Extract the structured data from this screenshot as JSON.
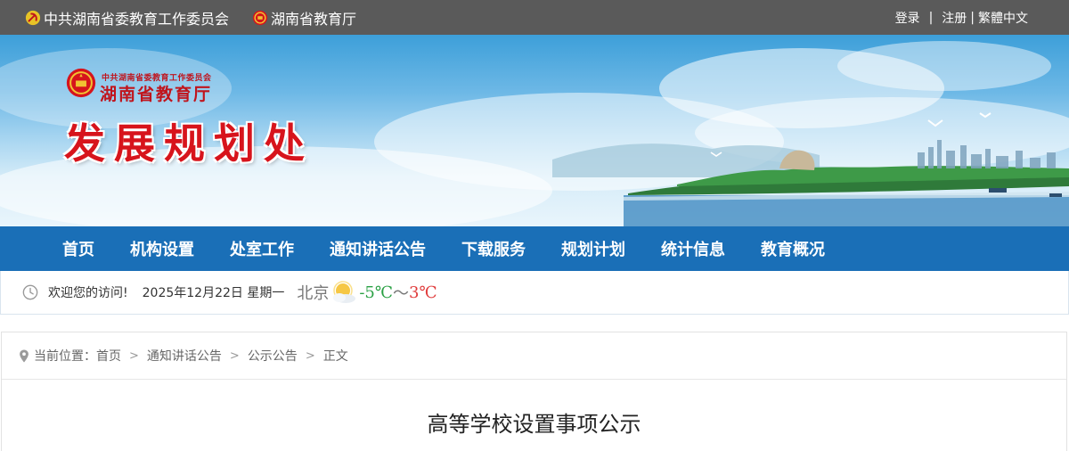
{
  "topbar": {
    "org1": "中共湖南省委教育工作委员会",
    "org2": "湖南省教育厅",
    "login": "登录",
    "register": "注册",
    "traditional": "繁體中文"
  },
  "banner": {
    "sub": "中共湖南省委教育工作委员会",
    "dept": "湖南省教育厅",
    "office": "发展规划处"
  },
  "nav": {
    "items": [
      {
        "label": "首页"
      },
      {
        "label": "机构设置"
      },
      {
        "label": "处室工作"
      },
      {
        "label": "通知讲话公告"
      },
      {
        "label": "下载服务"
      },
      {
        "label": "规划计划"
      },
      {
        "label": "统计信息"
      },
      {
        "label": "教育概况"
      }
    ]
  },
  "welcome": {
    "text": "欢迎您的访问!",
    "date": "2025年12月22日 星期一",
    "city": "北京",
    "temp_low": "-5℃",
    "tilde": "～",
    "temp_high": "3℃"
  },
  "breadcrumb": {
    "label": "当前位置：",
    "items": [
      "首页",
      "通知讲话公告",
      "公示公告",
      "正文"
    ]
  },
  "article": {
    "title": "高等学校设置事项公示"
  },
  "colors": {
    "topbar": "#5a5a5a",
    "nav": "#1a6fb7",
    "title_red": "#d7141c",
    "temp_low": "#2aa044",
    "temp_high": "#e03b3b"
  },
  "icons": [
    "party-emblem-icon",
    "national-emblem-icon",
    "clock-icon",
    "weather-sun-cloud-icon",
    "location-pin-icon",
    "chevron-right-icon"
  ]
}
